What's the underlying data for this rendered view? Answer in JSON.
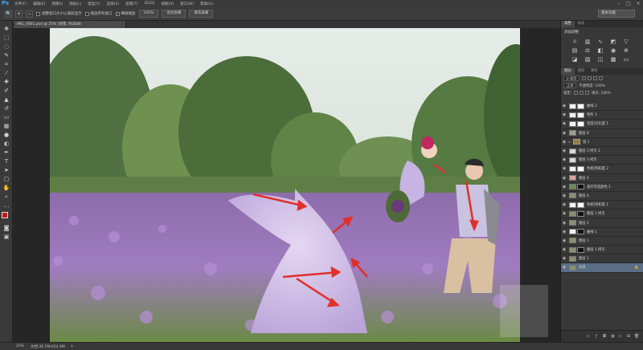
{
  "app": {
    "logo": "Ps"
  },
  "menu": [
    "文件(F)",
    "编辑(E)",
    "图像(I)",
    "图层(L)",
    "类型(Y)",
    "选择(S)",
    "滤镜(T)",
    "3D(D)",
    "视图(V)",
    "窗口(W)",
    "帮助(H)"
  ],
  "window_controls": [
    "–",
    "□",
    "×"
  ],
  "options": {
    "checks": [
      {
        "label": "调整窗口大小以满屏显示",
        "checked": false
      },
      {
        "label": "缩放所有窗口",
        "checked": false
      },
      {
        "label": "细微缩放",
        "checked": true
      }
    ],
    "buttons": [
      "100%",
      "适合屏幕",
      "填充屏幕"
    ],
    "workspace": "基本功能"
  },
  "document": {
    "tab_title": "IMG_0001.psd @ 25% (背景, RGB/8)"
  },
  "status": {
    "zoom": "25%",
    "doc_info": "文档:36.5M/424.9M"
  },
  "panel": {
    "tabs": [
      "调整",
      "样式"
    ],
    "adjust_title": "添加调整",
    "layer_tabs": [
      "图层",
      "通道",
      "路径"
    ],
    "filter_label": "ρ 类型",
    "blend_mode": "正常",
    "opacity_label": "不透明度: 100%",
    "lock_label": "锁定:",
    "fill_label": "填充: 100%"
  },
  "layers": [
    {
      "name": "曲线 2",
      "thumb": "#f2f2f2",
      "mask": "#ffffff",
      "eye": true
    },
    {
      "name": "色阶 1",
      "thumb": "#f2f2f2",
      "mask": "#ffffff",
      "eye": true
    },
    {
      "name": "亮度/对比度 1",
      "thumb": "#f2f2f2",
      "mask": "#ffffff",
      "eye": true
    },
    {
      "name": "图层 8",
      "thumb": "#9aa08c",
      "mask": "",
      "eye": true
    },
    {
      "name": "组 1",
      "thumb": "",
      "mask": "",
      "eye": true,
      "folder": true
    },
    {
      "name": "图层 3 拷贝 2",
      "thumb": "#d8d8d8",
      "mask": "",
      "eye": true
    },
    {
      "name": "图层 3 拷贝",
      "thumb": "#d8d8d8",
      "mask": "",
      "eye": true
    },
    {
      "name": "色相/饱和度 2",
      "thumb": "#f2f2f2",
      "mask": "#ffffff",
      "eye": true
    },
    {
      "name": "图层 4",
      "thumb": "#d9a0a0",
      "mask": "",
      "eye": true
    },
    {
      "name": "盖印可选颜色 1",
      "thumb": "#6a8a5a",
      "mask": "#111111",
      "eye": true
    },
    {
      "name": "图层 4",
      "thumb": "#8a9070",
      "mask": "",
      "eye": true
    },
    {
      "name": "色相/饱和度 1",
      "thumb": "#f2f2f2",
      "mask": "#ffffff",
      "eye": true
    },
    {
      "name": "图层 1 拷贝",
      "thumb": "#8a9070",
      "mask": "#111111",
      "eye": true
    },
    {
      "name": "图层 2",
      "thumb": "#8a9070",
      "mask": "",
      "eye": true
    },
    {
      "name": "曲线 1",
      "thumb": "#f2f2f2",
      "mask": "#111111",
      "eye": true
    },
    {
      "name": "图层 1",
      "thumb": "#8a9070",
      "mask": "",
      "eye": true
    },
    {
      "name": "图层 1 拷贝",
      "thumb": "#8a9070",
      "mask": "#111111",
      "eye": true
    },
    {
      "name": "图层 1",
      "thumb": "#8a9070",
      "mask": "",
      "eye": true
    },
    {
      "name": "背景",
      "thumb": "#8a9070",
      "mask": "",
      "eye": true,
      "selected": true,
      "locked": true
    }
  ],
  "colors": {
    "foreground": "#c01a1a",
    "background": "#ffffff",
    "accent": "#3ea6ff",
    "arrow": "#e0302a"
  }
}
